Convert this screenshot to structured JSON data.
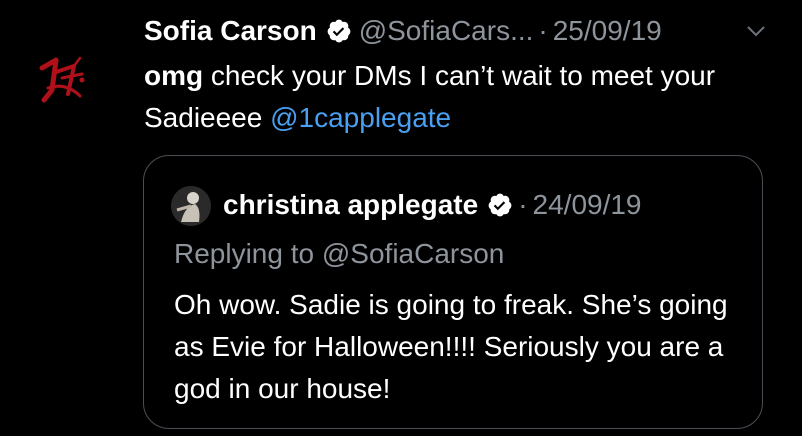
{
  "tweet": {
    "author_name": "Sofia Carson",
    "author_handle": "@SofiaCars...",
    "date": "25/09/19",
    "separator": "·",
    "body_bold": "omg",
    "body_text": " check your DMs I can’t wait to meet your Sadieeee ",
    "body_mention": "@1capplegate",
    "avatar_icon": "monogram-logo-icon",
    "verified_icon": "verified-badge-icon",
    "menu_icon": "chevron-down-icon"
  },
  "quoted_tweet": {
    "author_name": "christina applegate",
    "date": "24/09/19",
    "separator": "·",
    "replying_to": "Replying to @SofiaCarson",
    "body_text": "Oh wow. Sadie is going to freak. She’s going as Evie for Halloween!!!! Seriously you are a god in our house!",
    "avatar_icon": "profile-photo-icon",
    "verified_icon": "verified-badge-icon"
  },
  "colors": {
    "background": "#000000",
    "text": "#ffffff",
    "muted": "#8e949c",
    "link": "#4a9ff0",
    "border": "#4a4f55",
    "logo_red": "#b0101a"
  }
}
